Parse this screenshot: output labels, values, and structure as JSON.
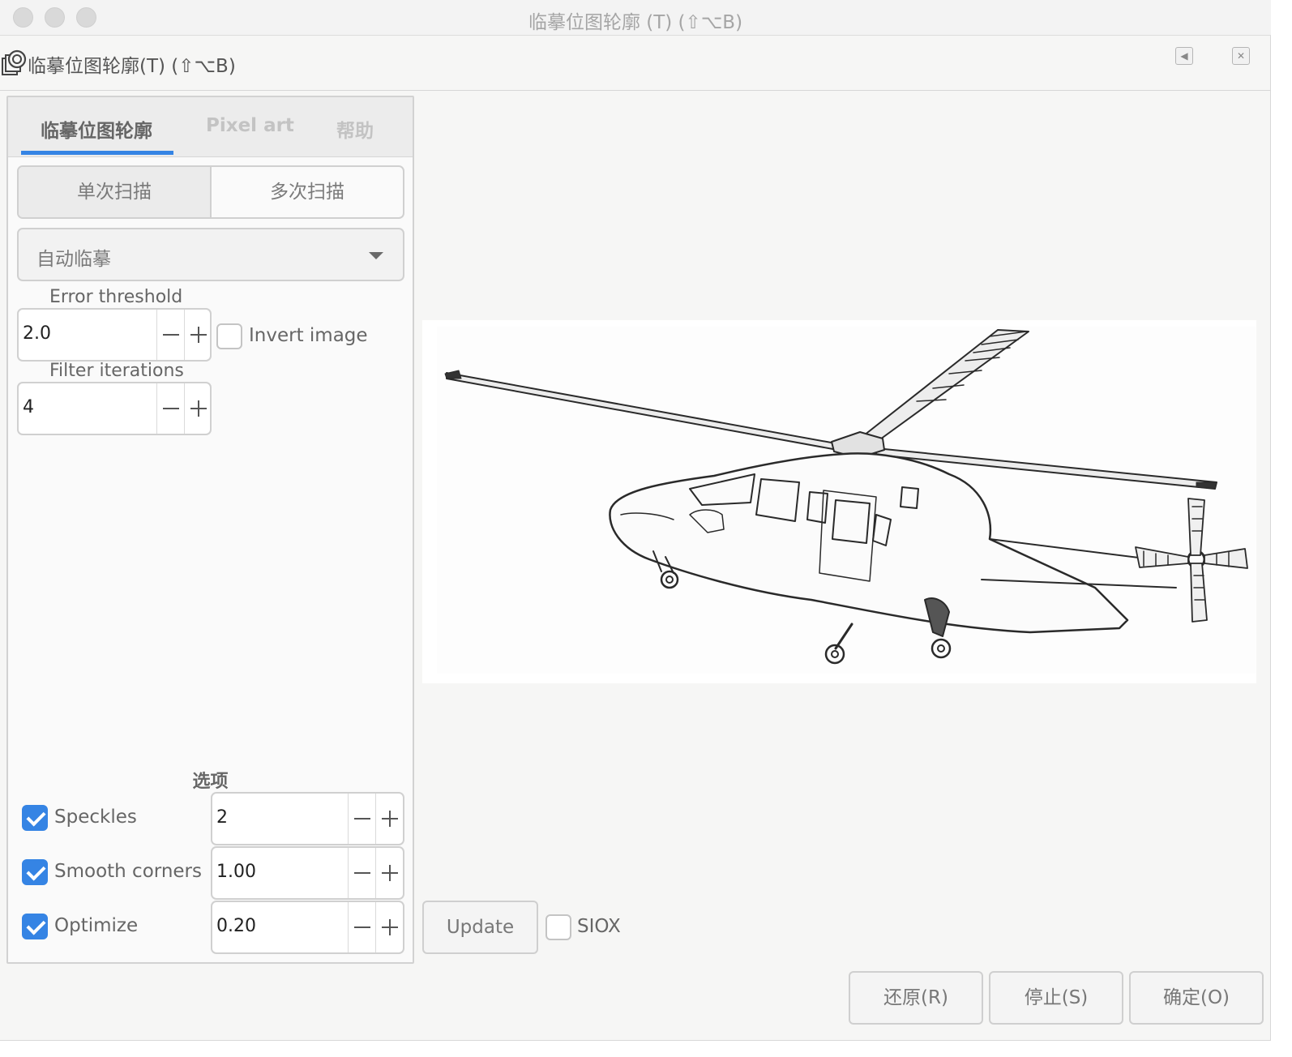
{
  "window": {
    "title": "临摹位图轮廓 (T) (⇧⌥B)"
  },
  "dock": {
    "title": "临摹位图轮廓(T) (⇧⌥B)",
    "icon": "trace-bitmap-icon"
  },
  "tabs": [
    {
      "label": "临摹位图轮廓",
      "active": true
    },
    {
      "label": "Pixel art",
      "active": false
    },
    {
      "label": "帮助",
      "active": false
    }
  ],
  "scan_mode": {
    "single": "单次扫描",
    "multiple": "多次扫描",
    "selected": "单次扫描"
  },
  "trace_mode": {
    "selected": "自动临摹"
  },
  "error_threshold": {
    "label": "Error threshold",
    "value": "2.0"
  },
  "invert_image": {
    "label": "Invert image",
    "checked": false
  },
  "filter_iterations": {
    "label": "Filter iterations",
    "value": "4"
  },
  "options": {
    "title": "选项",
    "speckles": {
      "label": "Speckles",
      "checked": true,
      "value": "2"
    },
    "smooth_corners": {
      "label": "Smooth corners",
      "checked": true,
      "value": "1.00"
    },
    "optimize": {
      "label": "Optimize",
      "checked": true,
      "value": "0.20"
    }
  },
  "preview": {
    "update_label": "Update",
    "siox_label": "SIOX",
    "siox_checked": false
  },
  "footer": {
    "reset": "还原(R)",
    "stop": "停止(S)",
    "ok": "确定(O)"
  },
  "colors": {
    "accent": "#3584e4"
  }
}
